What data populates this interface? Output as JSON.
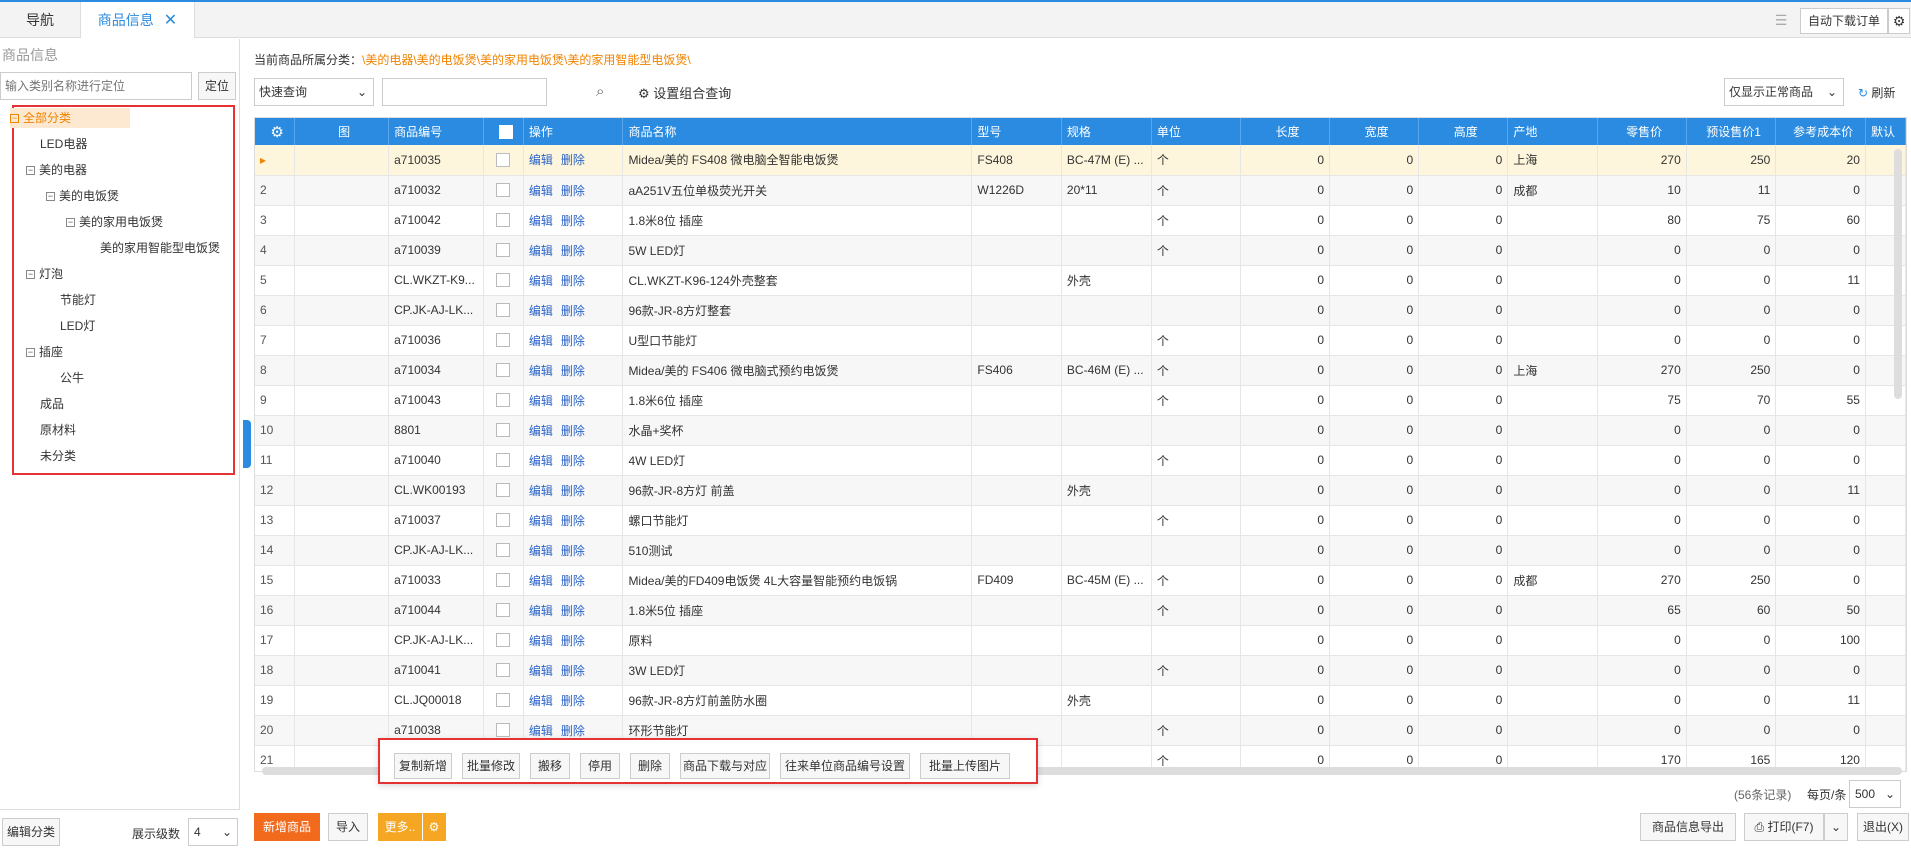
{
  "tabs": {
    "nav": "导航",
    "active": "商品信息",
    "close": "✕"
  },
  "topright": {
    "auto_download": "自动下载订单"
  },
  "left": {
    "title": "商品信息",
    "search_placeholder": "输入类别名称进行定位",
    "locate": "定位",
    "tree": [
      {
        "label": "全部分类",
        "toggle": "⊟",
        "root": true
      },
      {
        "label": "LED电器",
        "toggle": ""
      },
      {
        "label": "美的电器",
        "toggle": "⊟"
      },
      {
        "label": "美的电饭煲",
        "toggle": "⊟"
      },
      {
        "label": "美的家用电饭煲",
        "toggle": "⊟"
      },
      {
        "label": "美的家用智能型电饭煲",
        "toggle": ""
      },
      {
        "label": "灯泡",
        "toggle": "⊟"
      },
      {
        "label": "节能灯",
        "toggle": ""
      },
      {
        "label": "LED灯",
        "toggle": ""
      },
      {
        "label": "插座",
        "toggle": "⊟"
      },
      {
        "label": "公牛",
        "toggle": ""
      },
      {
        "label": "成品",
        "toggle": ""
      },
      {
        "label": "原材料",
        "toggle": ""
      },
      {
        "label": "未分类",
        "toggle": ""
      }
    ],
    "edit_category": "编辑分类",
    "level_label": "展示级数",
    "level_value": "4"
  },
  "main": {
    "breadcrumb_label": "当前商品所属分类：",
    "breadcrumb_path": "\\美的电器\\美的电饭煲\\美的家用电饭煲\\美的家用智能型电饭煲\\",
    "quick_query": "快速查询",
    "combo_query": "设置组合查询",
    "filter": "仅显示正常商品",
    "refresh": "刷新",
    "columns": [
      "图",
      "商品编号",
      "",
      "操作",
      "商品名称",
      "型号",
      "规格",
      "单位",
      "长度",
      "宽度",
      "高度",
      "产地",
      "零售价",
      "预设售价1",
      "参考成本价",
      "默认"
    ],
    "actions": {
      "edit": "编辑",
      "delete": "删除"
    },
    "rows": [
      [
        "▸",
        "a710035",
        "Midea/美的 FS408 微电脑全智能电饭煲",
        "FS408",
        "BC-47M (E) ...",
        "个",
        "0",
        "0",
        "0",
        "上海",
        "270",
        "250",
        "20"
      ],
      [
        "2",
        "a710032",
        "aA251V五位单极荧光开关",
        "W1226D",
        "20*11",
        "个",
        "0",
        "0",
        "0",
        "成都",
        "10",
        "11",
        "0"
      ],
      [
        "3",
        "a710042",
        "1.8米8位 插座",
        "",
        "",
        "个",
        "0",
        "0",
        "0",
        "",
        "80",
        "75",
        "60"
      ],
      [
        "4",
        "a710039",
        "5W LED灯",
        "",
        "",
        "个",
        "0",
        "0",
        "0",
        "",
        "0",
        "0",
        "0"
      ],
      [
        "5",
        "CL.WKZT-K9...",
        "CL.WKZT-K96-124外壳整套",
        "",
        "外壳",
        "",
        "0",
        "0",
        "0",
        "",
        "0",
        "0",
        "11"
      ],
      [
        "6",
        "CP.JK-AJ-LK...",
        "96款-JR-8方灯整套",
        "",
        "",
        "",
        "0",
        "0",
        "0",
        "",
        "0",
        "0",
        "0"
      ],
      [
        "7",
        "a710036",
        "U型口节能灯",
        "",
        "",
        "个",
        "0",
        "0",
        "0",
        "",
        "0",
        "0",
        "0"
      ],
      [
        "8",
        "a710034",
        "Midea/美的 FS406 微电脑式预约电饭煲",
        "FS406",
        "BC-46M (E) ...",
        "个",
        "0",
        "0",
        "0",
        "上海",
        "270",
        "250",
        "0"
      ],
      [
        "9",
        "a710043",
        "1.8米6位 插座",
        "",
        "",
        "个",
        "0",
        "0",
        "0",
        "",
        "75",
        "70",
        "55"
      ],
      [
        "10",
        "8801",
        "水晶+奖杯",
        "",
        "",
        "",
        "0",
        "0",
        "0",
        "",
        "0",
        "0",
        "0"
      ],
      [
        "11",
        "a710040",
        "4W LED灯",
        "",
        "",
        "个",
        "0",
        "0",
        "0",
        "",
        "0",
        "0",
        "0"
      ],
      [
        "12",
        "CL.WK00193",
        "96款-JR-8方灯 前盖",
        "",
        "外壳",
        "",
        "0",
        "0",
        "0",
        "",
        "0",
        "0",
        "11"
      ],
      [
        "13",
        "a710037",
        "螺口节能灯",
        "",
        "",
        "个",
        "0",
        "0",
        "0",
        "",
        "0",
        "0",
        "0"
      ],
      [
        "14",
        "CP.JK-AJ-LK...",
        "510测试",
        "",
        "",
        "",
        "0",
        "0",
        "0",
        "",
        "0",
        "0",
        "0"
      ],
      [
        "15",
        "a710033",
        "Midea/美的FD409电饭煲 4L大容量智能预约电饭锅",
        "FD409",
        "BC-45M (E) ...",
        "个",
        "0",
        "0",
        "0",
        "成都",
        "270",
        "250",
        "0"
      ],
      [
        "16",
        "a710044",
        "1.8米5位 插座",
        "",
        "",
        "个",
        "0",
        "0",
        "0",
        "",
        "65",
        "60",
        "50"
      ],
      [
        "17",
        "CP.JK-AJ-LK...",
        "原料",
        "",
        "",
        "",
        "0",
        "0",
        "0",
        "",
        "0",
        "0",
        "100"
      ],
      [
        "18",
        "a710041",
        "3W LED灯",
        "",
        "",
        "个",
        "0",
        "0",
        "0",
        "",
        "0",
        "0",
        "0"
      ],
      [
        "19",
        "CL.JQ00018",
        "96款-JR-8方灯前盖防水圈",
        "",
        "外壳",
        "",
        "0",
        "0",
        "0",
        "",
        "0",
        "0",
        "11"
      ],
      [
        "20",
        "a710038",
        "环形节能灯",
        "",
        "",
        "个",
        "0",
        "0",
        "0",
        "",
        "0",
        "0",
        "0"
      ],
      [
        "21",
        "",
        "",
        "",
        "",
        "个",
        "0",
        "0",
        "0",
        "",
        "170",
        "165",
        "120"
      ]
    ],
    "popup": [
      "复制新增",
      "批量修改",
      "搬移",
      "停用",
      "删除",
      "商品下载与对应",
      "往来单位商品编号设置",
      "批量上传图片"
    ],
    "record_count": "(56条记录)",
    "per_page_label": "每页/条",
    "per_page": "500",
    "bottom": {
      "add": "新增商品",
      "import": "导入",
      "more": "更多..",
      "export": "商品信息导出",
      "print": "打印(F7)",
      "exit": "退出(X)"
    }
  }
}
